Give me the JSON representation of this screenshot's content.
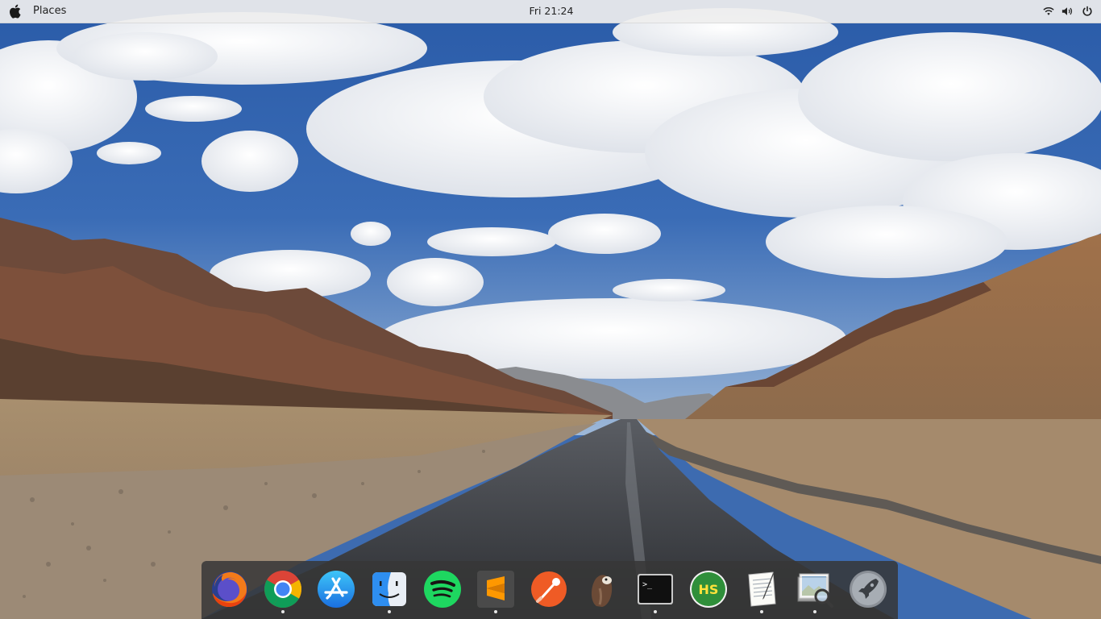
{
  "topbar": {
    "menu_label": "Places",
    "clock": "Fri 21:24",
    "tray": [
      "wifi-icon",
      "volume-icon",
      "power-icon"
    ]
  },
  "dock": {
    "items": [
      {
        "name": "firefox",
        "icon": "firefox-icon",
        "running": false
      },
      {
        "name": "chrome",
        "icon": "chrome-icon",
        "running": true
      },
      {
        "name": "app-store",
        "icon": "app-store-icon",
        "running": false
      },
      {
        "name": "finder",
        "icon": "finder-icon",
        "running": true
      },
      {
        "name": "spotify",
        "icon": "spotify-icon",
        "running": false
      },
      {
        "name": "sublime-text",
        "icon": "sublime-text-icon",
        "running": true
      },
      {
        "name": "postman",
        "icon": "postman-icon",
        "running": false
      },
      {
        "name": "sequel-pro",
        "icon": "sequel-pro-icon",
        "running": false
      },
      {
        "name": "terminal",
        "icon": "terminal-icon",
        "running": true
      },
      {
        "name": "hs",
        "icon": "hs-icon",
        "label": "HS",
        "running": false
      },
      {
        "name": "textedit",
        "icon": "textedit-icon",
        "running": true
      },
      {
        "name": "preview",
        "icon": "preview-icon",
        "running": true
      },
      {
        "name": "launchpad",
        "icon": "launchpad-icon",
        "running": false
      }
    ],
    "terminal_prompt": ">_"
  },
  "colors": {
    "sky": "#2f5da8",
    "cloud": "#f2f4f7",
    "dock_bg": "#373737",
    "topbar_bg": "#eeeeee"
  }
}
